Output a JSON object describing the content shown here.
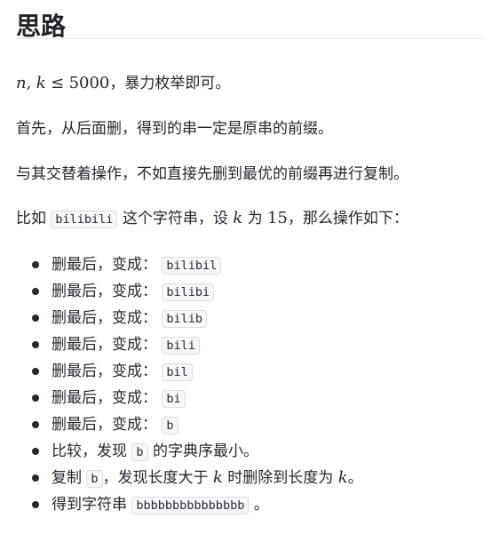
{
  "heading": "思路",
  "p1": {
    "var_n": "n",
    "comma": ",",
    "var_k": "k",
    "leq": "≤",
    "num": "5000",
    "text": "，暴力枚举即可。"
  },
  "p2": "首先，从后面删，得到的串一定是原串的前缀。",
  "p3": "与其交替着操作，不如直接先删到最优的前缀再进行复制。",
  "p4": {
    "prefix": "比如",
    "code": "bilibili",
    "mid": "这个字符串，设",
    "var_k": "k",
    "mid2": "为",
    "num": "15",
    "suffix": "，那么操作如下："
  },
  "steps": [
    {
      "text": "删最后，变成：",
      "code": "bilibil"
    },
    {
      "text": "删最后，变成：",
      "code": "bilibi"
    },
    {
      "text": "删最后，变成：",
      "code": "bilib"
    },
    {
      "text": "删最后，变成：",
      "code": "bili"
    },
    {
      "text": "删最后，变成：",
      "code": "bil"
    },
    {
      "text": "删最后，变成：",
      "code": "bi"
    },
    {
      "text": "删最后，变成：",
      "code": "b"
    }
  ],
  "compare": {
    "prefix": "比较，发现",
    "code": "b",
    "suffix": "的字典序最小。"
  },
  "copy": {
    "prefix": "复制",
    "code": "b",
    "mid": "，发现长度大于",
    "var_k": "k",
    "mid2": "时删除到长度为",
    "var_k2": "k",
    "suffix": "。"
  },
  "final": {
    "prefix": "得到字符串",
    "code": "bbbbbbbbbbbbbbb",
    "suffix": "。"
  }
}
